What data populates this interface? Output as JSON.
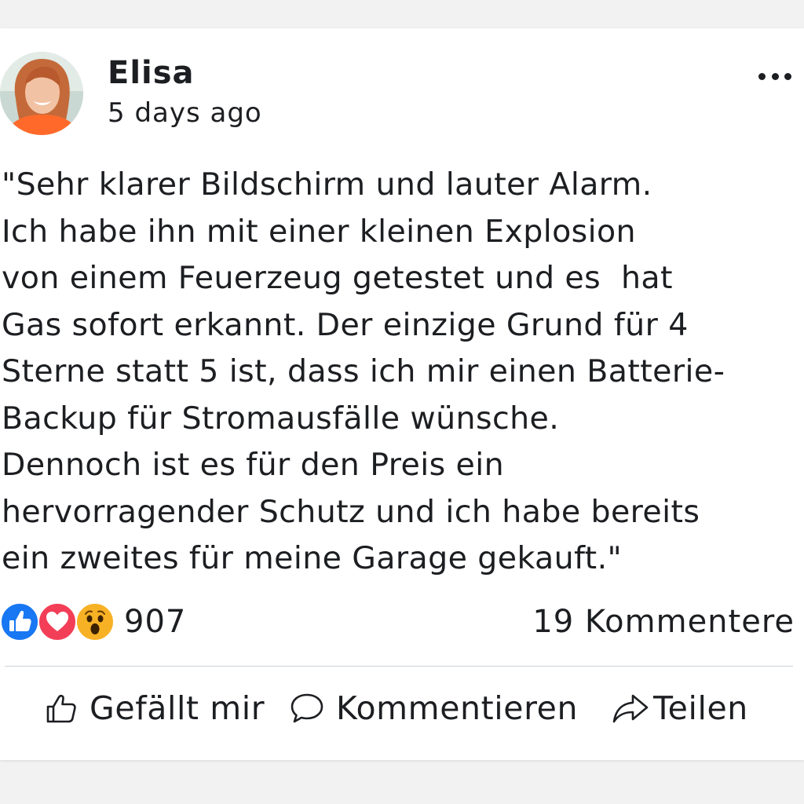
{
  "post": {
    "author": "Elisa",
    "time": "5 days ago",
    "text": [
      "\"Sehr klarer Bildschirm und lauter Alarm.",
      "Ich habe ihn mit einer kleinen Explosion",
      "von einem Feuerzeug getestet und es  hat",
      "Gas sofort erkannt. Der einzige Grund für 4",
      "Sterne statt 5 ist, dass ich mir einen Batterie-",
      "Backup für Stromausfälle wünsche.",
      "Dennoch ist es für den Preis ein",
      "hervorragender Schutz und ich habe bereits",
      "ein zweites für meine Garage gekauft.\""
    ]
  },
  "reactions": {
    "icons": [
      "like-icon",
      "love-icon",
      "wow-icon"
    ],
    "count": "907"
  },
  "comments": {
    "count_label": "19 Kommentere"
  },
  "actions": {
    "like_label": "Gefällt mir",
    "comment_label": "Kommentieren",
    "share_label": "Teilen"
  },
  "colors": {
    "like": "#1877f2",
    "love": "#f33e58",
    "wow": "#f7b125",
    "text": "#1c1e21",
    "divider": "#cfd3d8"
  }
}
